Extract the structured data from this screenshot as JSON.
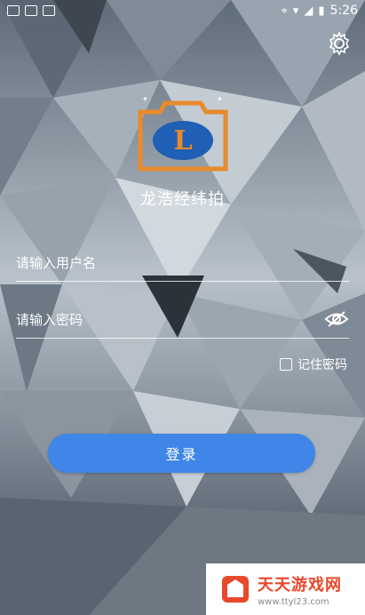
{
  "status_bar": {
    "time": "5:26",
    "icons": [
      "notification-icon",
      "keyboard-icon",
      "location-icon",
      "wifi-icon",
      "signal-icon",
      "battery-icon"
    ]
  },
  "header": {
    "settings_icon": "gear-icon"
  },
  "app": {
    "name": "龙浩经纬拍",
    "logo_icon": "camera-logo-icon",
    "colors": {
      "accent": "#3f86e8",
      "logo_orange": "#e98a2c",
      "logo_blue": "#1f5fb5"
    }
  },
  "form": {
    "username_placeholder": "请输入用户名",
    "password_placeholder": "请输入密码",
    "remember_label": "记住密码",
    "remember_checked": false,
    "show_password_icon": "eye-slash-icon",
    "login_label": "登录"
  },
  "watermark": {
    "title": "天天游戏网",
    "url": "www.ttyl23.com"
  }
}
